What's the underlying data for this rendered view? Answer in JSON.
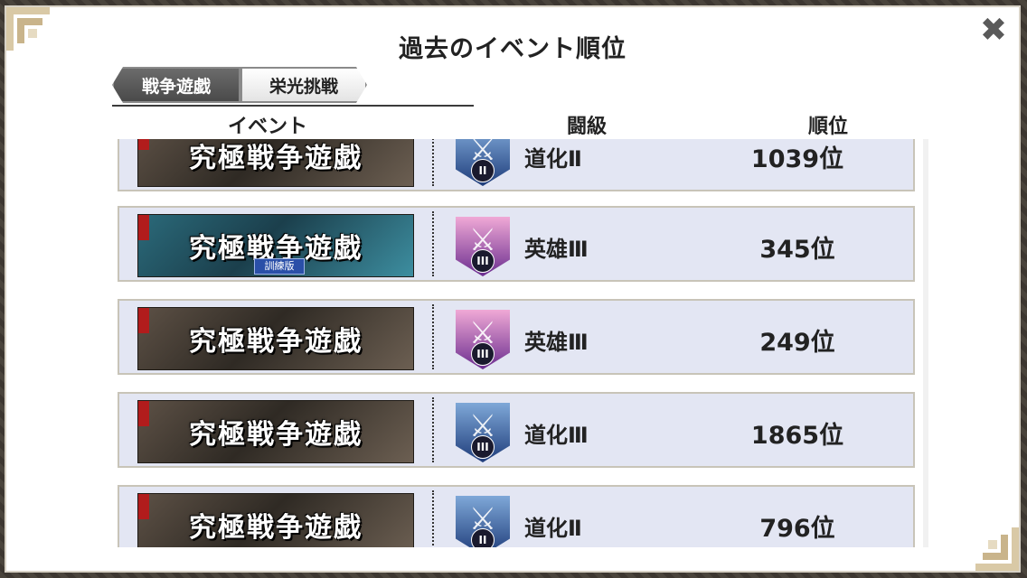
{
  "title": "過去のイベント順位",
  "tabs": [
    {
      "label": "戦争遊戯",
      "active": true
    },
    {
      "label": "栄光挑戦",
      "active": false
    }
  ],
  "columns": {
    "event": "イベント",
    "tier": "闘級",
    "rank": "順位"
  },
  "rows": [
    {
      "event_banner": "究極戦争遊戯",
      "banner_sub": "",
      "tier_icon": "clown-rank-icon",
      "tier_numeral": "II",
      "tier": "道化Ⅱ",
      "rank": "1039位"
    },
    {
      "event_banner": "究極戦争遊戯",
      "banner_sub": "訓練版",
      "tier_icon": "hero-rank-icon",
      "tier_numeral": "III",
      "tier": "英雄Ⅲ",
      "rank": "345位"
    },
    {
      "event_banner": "究極戦争遊戯",
      "banner_sub": "",
      "tier_icon": "hero-rank-icon",
      "tier_numeral": "III",
      "tier": "英雄Ⅲ",
      "rank": "249位"
    },
    {
      "event_banner": "究極戦争遊戯",
      "banner_sub": "",
      "tier_icon": "clown-rank-icon",
      "tier_numeral": "III",
      "tier": "道化Ⅲ",
      "rank": "1865位"
    },
    {
      "event_banner": "究極戦争遊戯",
      "banner_sub": "",
      "tier_icon": "clown-rank-icon",
      "tier_numeral": "II",
      "tier": "道化Ⅱ",
      "rank": "796位"
    }
  ],
  "colors": {
    "row_bg": "#e3e6f3",
    "tab_active": "#4a4a4a"
  }
}
